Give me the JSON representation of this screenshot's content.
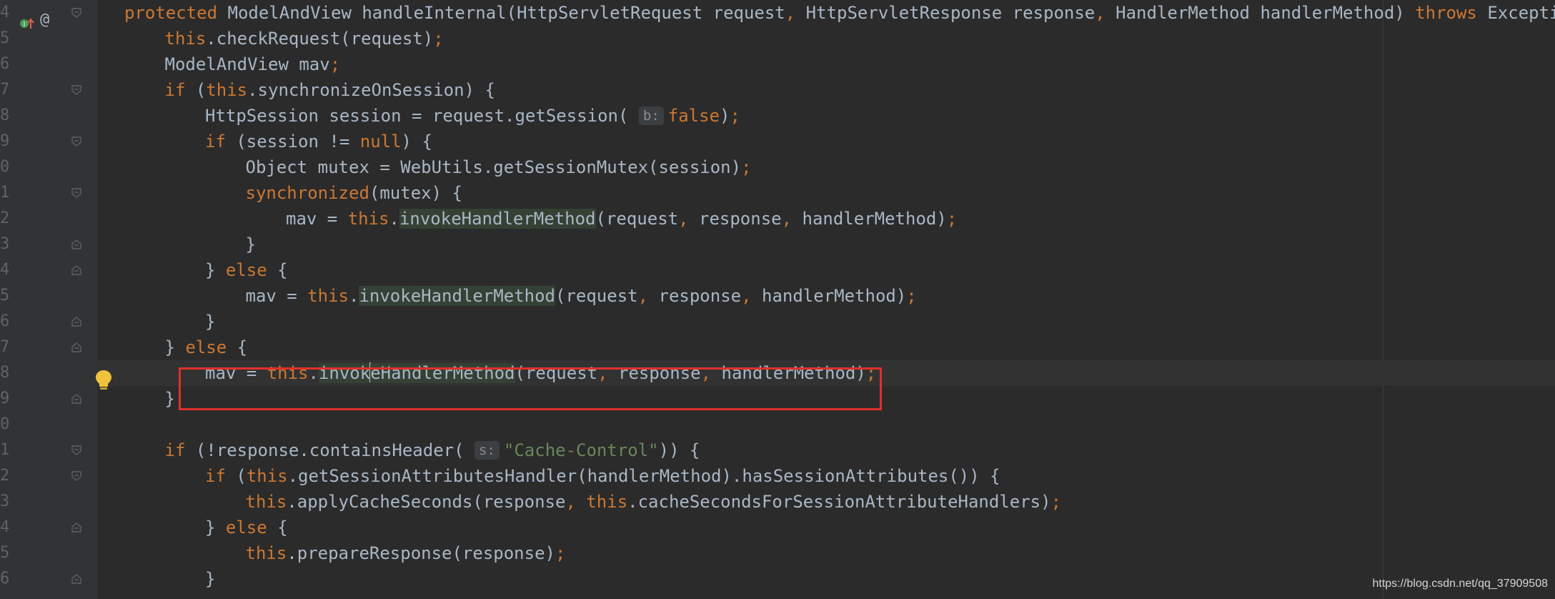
{
  "gutter": {
    "line_numbers": [
      "4",
      "5",
      "6",
      "7",
      "8",
      "9",
      "0",
      "1",
      "2",
      "3",
      "4",
      "5",
      "6",
      "7",
      "8",
      "9",
      "0",
      "1",
      "2",
      "3",
      "4",
      "5",
      "6"
    ],
    "annotations": {
      "implements_icon": "implements-method-icon",
      "at_symbol": "@"
    }
  },
  "code": {
    "lines": [
      {
        "indent": 0,
        "tokens": [
          {
            "t": "protected ",
            "c": "kw"
          },
          {
            "t": "ModelAndView handleInternal(HttpServletRequest request"
          },
          {
            "t": ",",
            "c": "kw"
          },
          {
            "t": " HttpServletResponse response"
          },
          {
            "t": ",",
            "c": "kw"
          },
          {
            "t": " HandlerMethod handlerMethod) "
          },
          {
            "t": "throws ",
            "c": "kw"
          },
          {
            "t": "Exception {"
          }
        ]
      },
      {
        "indent": 1,
        "tokens": [
          {
            "t": "this",
            "c": "kw"
          },
          {
            "t": ".checkRequest(request)"
          },
          {
            "t": ";",
            "c": "kw"
          }
        ]
      },
      {
        "indent": 1,
        "tokens": [
          {
            "t": "ModelAndView mav"
          },
          {
            "t": ";",
            "c": "kw"
          }
        ]
      },
      {
        "indent": 1,
        "tokens": [
          {
            "t": "if ",
            "c": "kw"
          },
          {
            "t": "("
          },
          {
            "t": "this",
            "c": "kw"
          },
          {
            "t": ".synchronizeOnSession) {"
          }
        ]
      },
      {
        "indent": 2,
        "tokens": [
          {
            "t": "HttpSession session = request.getSession( "
          },
          {
            "t": "b:",
            "c": "hint"
          },
          {
            "t": "false",
            "c": "kw"
          },
          {
            "t": ")"
          },
          {
            "t": ";",
            "c": "kw"
          }
        ]
      },
      {
        "indent": 2,
        "tokens": [
          {
            "t": "if ",
            "c": "kw"
          },
          {
            "t": "(session != "
          },
          {
            "t": "null",
            "c": "kw"
          },
          {
            "t": ") {"
          }
        ]
      },
      {
        "indent": 3,
        "tokens": [
          {
            "t": "Object mutex = WebUtils.getSessionMutex(session)"
          },
          {
            "t": ";",
            "c": "kw"
          }
        ]
      },
      {
        "indent": 3,
        "tokens": [
          {
            "t": "synchronized",
            "c": "kw"
          },
          {
            "t": "(mutex) {"
          }
        ]
      },
      {
        "indent": 4,
        "tokens": [
          {
            "t": "mav = "
          },
          {
            "t": "this",
            "c": "kw"
          },
          {
            "t": "."
          },
          {
            "t": "invokeHandlerMethod",
            "c": "hl"
          },
          {
            "t": "(request"
          },
          {
            "t": ",",
            "c": "kw"
          },
          {
            "t": " response"
          },
          {
            "t": ",",
            "c": "kw"
          },
          {
            "t": " handlerMethod)"
          },
          {
            "t": ";",
            "c": "kw"
          }
        ]
      },
      {
        "indent": 3,
        "tokens": [
          {
            "t": "}"
          }
        ]
      },
      {
        "indent": 2,
        "tokens": [
          {
            "t": "} "
          },
          {
            "t": "else ",
            "c": "kw"
          },
          {
            "t": "{"
          }
        ]
      },
      {
        "indent": 3,
        "tokens": [
          {
            "t": "mav = "
          },
          {
            "t": "this",
            "c": "kw"
          },
          {
            "t": "."
          },
          {
            "t": "invokeHandlerMethod",
            "c": "hl"
          },
          {
            "t": "(request"
          },
          {
            "t": ",",
            "c": "kw"
          },
          {
            "t": " response"
          },
          {
            "t": ",",
            "c": "kw"
          },
          {
            "t": " handlerMethod)"
          },
          {
            "t": ";",
            "c": "kw"
          }
        ]
      },
      {
        "indent": 2,
        "tokens": [
          {
            "t": "}"
          }
        ]
      },
      {
        "indent": 1,
        "tokens": [
          {
            "t": "} "
          },
          {
            "t": "else ",
            "c": "kw"
          },
          {
            "t": "{"
          }
        ]
      },
      {
        "indent": 2,
        "tokens": [
          {
            "t": "mav = "
          },
          {
            "t": "this",
            "c": "kw"
          },
          {
            "t": "."
          },
          {
            "t": "invok",
            "c": "hl"
          },
          {
            "t": "|",
            "c": "caret"
          },
          {
            "t": "eHandlerMethod",
            "c": "hl"
          },
          {
            "t": "(request"
          },
          {
            "t": ",",
            "c": "kw"
          },
          {
            "t": " response"
          },
          {
            "t": ",",
            "c": "kw"
          },
          {
            "t": " handlerMethod)"
          },
          {
            "t": ";",
            "c": "kw"
          }
        ],
        "current": true
      },
      {
        "indent": 1,
        "tokens": [
          {
            "t": "}"
          }
        ]
      },
      {
        "indent": 0,
        "tokens": []
      },
      {
        "indent": 1,
        "tokens": [
          {
            "t": "if ",
            "c": "kw"
          },
          {
            "t": "(!response.containsHeader( "
          },
          {
            "t": "s:",
            "c": "hint"
          },
          {
            "t": "\"Cache-Control\"",
            "c": "str"
          },
          {
            "t": ")) {"
          }
        ]
      },
      {
        "indent": 2,
        "tokens": [
          {
            "t": "if ",
            "c": "kw"
          },
          {
            "t": "("
          },
          {
            "t": "this",
            "c": "kw"
          },
          {
            "t": ".getSessionAttributesHandler(handlerMethod).hasSessionAttributes()) {"
          }
        ]
      },
      {
        "indent": 3,
        "tokens": [
          {
            "t": "this",
            "c": "kw"
          },
          {
            "t": ".applyCacheSeconds(response"
          },
          {
            "t": ",",
            "c": "kw"
          },
          {
            "t": " "
          },
          {
            "t": "this",
            "c": "kw"
          },
          {
            "t": ".cacheSecondsForSessionAttributeHandlers)"
          },
          {
            "t": ";",
            "c": "kw"
          }
        ]
      },
      {
        "indent": 2,
        "tokens": [
          {
            "t": "} "
          },
          {
            "t": "else ",
            "c": "kw"
          },
          {
            "t": "{"
          }
        ]
      },
      {
        "indent": 3,
        "tokens": [
          {
            "t": "this",
            "c": "kw"
          },
          {
            "t": ".prepareResponse(response)"
          },
          {
            "t": ";",
            "c": "kw"
          }
        ]
      },
      {
        "indent": 2,
        "tokens": [
          {
            "t": "}"
          }
        ]
      }
    ]
  },
  "folds": [
    "open",
    "none",
    "none",
    "open",
    "none",
    "open",
    "none",
    "open",
    "none",
    "close",
    "close",
    "none",
    "close",
    "close",
    "none",
    "close",
    "none",
    "open",
    "open",
    "none",
    "close",
    "none",
    "close"
  ],
  "highlight_box_color": "#e0302b",
  "watermark": "https://blog.csdn.net/qq_37909508"
}
